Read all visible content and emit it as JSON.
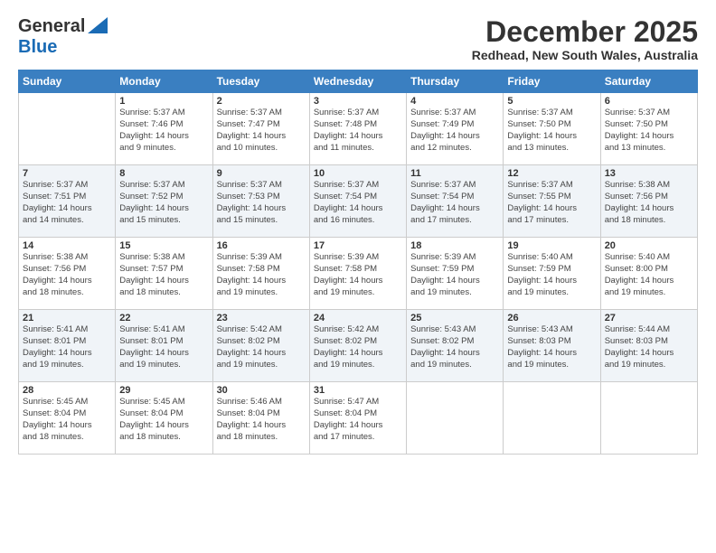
{
  "header": {
    "logo": {
      "line1": "General",
      "line2": "Blue"
    },
    "title": "December 2025",
    "location": "Redhead, New South Wales, Australia"
  },
  "calendar": {
    "days_of_week": [
      "Sunday",
      "Monday",
      "Tuesday",
      "Wednesday",
      "Thursday",
      "Friday",
      "Saturday"
    ],
    "weeks": [
      [
        {
          "num": "",
          "info": ""
        },
        {
          "num": "1",
          "info": "Sunrise: 5:37 AM\nSunset: 7:46 PM\nDaylight: 14 hours\nand 9 minutes."
        },
        {
          "num": "2",
          "info": "Sunrise: 5:37 AM\nSunset: 7:47 PM\nDaylight: 14 hours\nand 10 minutes."
        },
        {
          "num": "3",
          "info": "Sunrise: 5:37 AM\nSunset: 7:48 PM\nDaylight: 14 hours\nand 11 minutes."
        },
        {
          "num": "4",
          "info": "Sunrise: 5:37 AM\nSunset: 7:49 PM\nDaylight: 14 hours\nand 12 minutes."
        },
        {
          "num": "5",
          "info": "Sunrise: 5:37 AM\nSunset: 7:50 PM\nDaylight: 14 hours\nand 13 minutes."
        },
        {
          "num": "6",
          "info": "Sunrise: 5:37 AM\nSunset: 7:50 PM\nDaylight: 14 hours\nand 13 minutes."
        }
      ],
      [
        {
          "num": "7",
          "info": "Sunrise: 5:37 AM\nSunset: 7:51 PM\nDaylight: 14 hours\nand 14 minutes."
        },
        {
          "num": "8",
          "info": "Sunrise: 5:37 AM\nSunset: 7:52 PM\nDaylight: 14 hours\nand 15 minutes."
        },
        {
          "num": "9",
          "info": "Sunrise: 5:37 AM\nSunset: 7:53 PM\nDaylight: 14 hours\nand 15 minutes."
        },
        {
          "num": "10",
          "info": "Sunrise: 5:37 AM\nSunset: 7:54 PM\nDaylight: 14 hours\nand 16 minutes."
        },
        {
          "num": "11",
          "info": "Sunrise: 5:37 AM\nSunset: 7:54 PM\nDaylight: 14 hours\nand 17 minutes."
        },
        {
          "num": "12",
          "info": "Sunrise: 5:37 AM\nSunset: 7:55 PM\nDaylight: 14 hours\nand 17 minutes."
        },
        {
          "num": "13",
          "info": "Sunrise: 5:38 AM\nSunset: 7:56 PM\nDaylight: 14 hours\nand 18 minutes."
        }
      ],
      [
        {
          "num": "14",
          "info": "Sunrise: 5:38 AM\nSunset: 7:56 PM\nDaylight: 14 hours\nand 18 minutes."
        },
        {
          "num": "15",
          "info": "Sunrise: 5:38 AM\nSunset: 7:57 PM\nDaylight: 14 hours\nand 18 minutes."
        },
        {
          "num": "16",
          "info": "Sunrise: 5:39 AM\nSunset: 7:58 PM\nDaylight: 14 hours\nand 19 minutes."
        },
        {
          "num": "17",
          "info": "Sunrise: 5:39 AM\nSunset: 7:58 PM\nDaylight: 14 hours\nand 19 minutes."
        },
        {
          "num": "18",
          "info": "Sunrise: 5:39 AM\nSunset: 7:59 PM\nDaylight: 14 hours\nand 19 minutes."
        },
        {
          "num": "19",
          "info": "Sunrise: 5:40 AM\nSunset: 7:59 PM\nDaylight: 14 hours\nand 19 minutes."
        },
        {
          "num": "20",
          "info": "Sunrise: 5:40 AM\nSunset: 8:00 PM\nDaylight: 14 hours\nand 19 minutes."
        }
      ],
      [
        {
          "num": "21",
          "info": "Sunrise: 5:41 AM\nSunset: 8:01 PM\nDaylight: 14 hours\nand 19 minutes."
        },
        {
          "num": "22",
          "info": "Sunrise: 5:41 AM\nSunset: 8:01 PM\nDaylight: 14 hours\nand 19 minutes."
        },
        {
          "num": "23",
          "info": "Sunrise: 5:42 AM\nSunset: 8:02 PM\nDaylight: 14 hours\nand 19 minutes."
        },
        {
          "num": "24",
          "info": "Sunrise: 5:42 AM\nSunset: 8:02 PM\nDaylight: 14 hours\nand 19 minutes."
        },
        {
          "num": "25",
          "info": "Sunrise: 5:43 AM\nSunset: 8:02 PM\nDaylight: 14 hours\nand 19 minutes."
        },
        {
          "num": "26",
          "info": "Sunrise: 5:43 AM\nSunset: 8:03 PM\nDaylight: 14 hours\nand 19 minutes."
        },
        {
          "num": "27",
          "info": "Sunrise: 5:44 AM\nSunset: 8:03 PM\nDaylight: 14 hours\nand 19 minutes."
        }
      ],
      [
        {
          "num": "28",
          "info": "Sunrise: 5:45 AM\nSunset: 8:04 PM\nDaylight: 14 hours\nand 18 minutes."
        },
        {
          "num": "29",
          "info": "Sunrise: 5:45 AM\nSunset: 8:04 PM\nDaylight: 14 hours\nand 18 minutes."
        },
        {
          "num": "30",
          "info": "Sunrise: 5:46 AM\nSunset: 8:04 PM\nDaylight: 14 hours\nand 18 minutes."
        },
        {
          "num": "31",
          "info": "Sunrise: 5:47 AM\nSunset: 8:04 PM\nDaylight: 14 hours\nand 17 minutes."
        },
        {
          "num": "",
          "info": ""
        },
        {
          "num": "",
          "info": ""
        },
        {
          "num": "",
          "info": ""
        }
      ]
    ]
  }
}
